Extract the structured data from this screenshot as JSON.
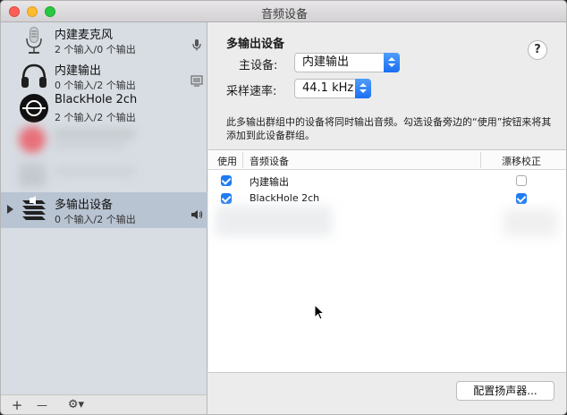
{
  "window": {
    "title": "音频设备"
  },
  "sidebar": {
    "devices": [
      {
        "name": "内建麦克风",
        "subtitle": "2 个输入/0 个输出",
        "icon": "microphone-icon",
        "side_icon": "mic-small-icon"
      },
      {
        "name": "内建输出",
        "subtitle": "0 个输入/2 个输出",
        "icon": "headphones-icon",
        "side_icon": "display-icon"
      },
      {
        "name": "BlackHole 2ch",
        "subtitle": "2 个输入/2 个输出",
        "icon": "blackhole-icon",
        "side_icon": ""
      },
      {
        "name": "多输出设备",
        "subtitle": "0 个输入/2 个输出",
        "icon": "multi-output-icon",
        "side_icon": "speaker-icon",
        "selected": true
      }
    ],
    "footer": {
      "add_label": "+",
      "remove_label": "—",
      "gear_label": "⚙︎▾"
    }
  },
  "main": {
    "group_title": "多输出设备",
    "help_label": "?",
    "master_label": "主设备:",
    "master_value": "内建输出",
    "rate_label": "采样速率:",
    "rate_value": "44.1 kHz",
    "description": "此多输出群组中的设备将同时输出音频。勾选设备旁边的“使用”按钮来将其添加到此设备群组。",
    "table": {
      "headers": {
        "use": "使用",
        "device": "音频设备",
        "drift": "漂移校正"
      },
      "rows": [
        {
          "use": true,
          "device": "内建输出",
          "drift": false
        },
        {
          "use": true,
          "device": "BlackHole 2ch",
          "drift": true
        }
      ]
    },
    "config_button": "配置扬声器..."
  },
  "colors": {
    "accent": "#1e7bf3",
    "selection": "#b9c4d2",
    "sidebar": "#d7dde3"
  }
}
